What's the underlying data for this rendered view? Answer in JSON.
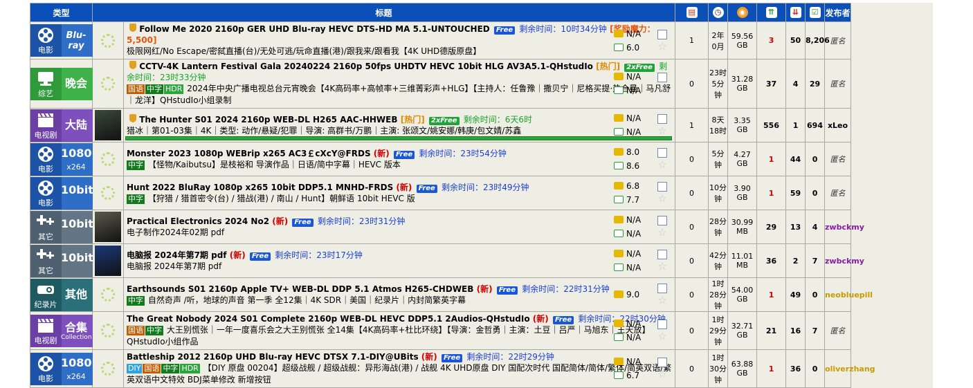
{
  "header": {
    "type_label": "类型",
    "title_label": "标题",
    "uploader_label": "发布者",
    "icon_names": [
      "comments-icon",
      "time-icon",
      "size-icon",
      "seeders-icon",
      "leechers-icon",
      "completed-icon"
    ]
  },
  "rows": [
    {
      "cat_label": "电影",
      "cat_big": "Blu-ray",
      "cat_sub": "",
      "cat_style": "c-blue",
      "cat_icon": "film-reel-icon",
      "poster": false,
      "title": "Follow Me 2020 2160p GER UHD Blu-ray HEVC DTS-HD MA 5.1-UNTOUCHED",
      "flag": "",
      "free": "Free",
      "remain": "剩余时间：10时34分钟",
      "magic": "[奖励魔力：5,500]",
      "tags": [],
      "subtitle": "极限网红/No Escape/密弑直播(台)/无处可逃/玩命直播(港)/跟我来/跟看我【4K UHD德版原盘】",
      "imdb": "N/A",
      "douban": "6.0",
      "comments": "1",
      "time": "2年\n0月",
      "size": "59.56\nGB",
      "seeders": "3",
      "seed_red": true,
      "leechers": "50",
      "completed": "8,206",
      "uploader": "匿名",
      "uploader_style": "anon"
    },
    {
      "cat_label": "综艺",
      "cat_big": "晚会",
      "cat_sub": "",
      "cat_style": "c-green",
      "cat_icon": "tv-stand-icon",
      "poster": false,
      "title": "CCTV-4K Lantern Festival Gala 20240224 2160p 50fps UHDTV HEVC 10bit HLG AV3A5.1-QHstudIo",
      "flag": "[热门]",
      "free": "2xFree",
      "remain": "剩余时间：23时33分钟",
      "magic": "",
      "tags": [
        "国语",
        "中字",
        "HDR"
      ],
      "subtitle": "2024年中央广播电视总台元宵晚会【4K高码率+高帧率+三维菁彩声+HLG】【主持人：任鲁豫｜撒贝宁｜尼格买提·热合曼｜马凡舒｜龙洋】QHstudIo小组录制",
      "imdb": "N/A",
      "douban": "N/A",
      "comments": "0",
      "time": "23时\n5分钟",
      "size": "31.28\nGB",
      "seeders": "37",
      "seed_red": false,
      "leechers": "4",
      "completed": "29",
      "uploader": "匿名",
      "uploader_style": "anon"
    },
    {
      "cat_label": "电视剧",
      "cat_big": "大陆",
      "cat_sub": "",
      "cat_style": "c-purple",
      "cat_icon": "clapperboard-icon",
      "poster": true,
      "poster_color": "#3a4a3a",
      "title": "The Hunter S01 2024 2160p WEB-DL H265 AAC-HHWEB",
      "flag": "[热门]",
      "free": "2xFree",
      "remain": "剩余时间：6天6时",
      "magic": "",
      "tags": [],
      "subtitle": "猎冰｜第01-03集｜4K｜类型: 动作/悬疑/犯罪｜导演: 高群书/万鹏｜主演: 张颂文/姚安娜/韩庚/包文婧/苏鑫",
      "imdb": "N/A",
      "douban": "N/A",
      "progress": 1.0,
      "comments": "1",
      "time": "8天\n18时",
      "size": "3.35\nGB",
      "seeders": "556",
      "seed_red": false,
      "leechers": "1",
      "completed": "694",
      "uploader": "xLeo",
      "uploader_style": "black"
    },
    {
      "cat_label": "电影",
      "cat_big": "1080",
      "cat_sub": "x264",
      "cat_style": "c-blue",
      "cat_icon": "film-reel-icon",
      "poster": false,
      "title": "Monster 2023 1080p WEBrip x265 AC3￡cXcY@FRDS",
      "flag": "(新)",
      "free": "Free",
      "remain": "剩余时间：23时54分钟",
      "magic": "",
      "tags": [
        "中字"
      ],
      "subtitle": "【怪物/Kaibutsu】是枝裕和 导演作品｜日语/简中字幕｜HEVC 版本",
      "imdb": "8.0",
      "douban": "8.6",
      "comments": "0",
      "time": "5分钟",
      "size": "4.27\nGB",
      "seeders": "1",
      "seed_red": true,
      "leechers": "44",
      "completed": "0",
      "uploader": "匿名",
      "uploader_style": "anon"
    },
    {
      "cat_label": "电影",
      "cat_big": "10bit",
      "cat_sub": "",
      "cat_style": "c-blue",
      "cat_icon": "film-reel-icon",
      "poster": false,
      "title": "Hunt 2022 BluRay 1080p x265 10bit DDP5.1 MNHD-FRDS",
      "flag": "(新)",
      "free": "Free",
      "remain": "剩余时间：23时49分钟",
      "magic": "",
      "tags": [
        "中字"
      ],
      "subtitle": "【狩猎 / 猎首密令(台) / 猎战(港) / 南山 / Hunt】朝鲜语 10bit HEVC 版",
      "imdb": "6.8",
      "douban": "7.7",
      "comments": "0",
      "time": "10分钟",
      "size": "3.90\nGB",
      "seeders": "1",
      "seed_red": true,
      "leechers": "59",
      "completed": "0",
      "uploader": "匿名",
      "uploader_style": "anon"
    },
    {
      "cat_label": "其它",
      "cat_big": "10bit",
      "cat_sub": "",
      "cat_style": "c-gray",
      "cat_icon": "plus-plus-icon",
      "poster": true,
      "poster_color": "#5a5a4a",
      "title": "Practical Electronics 2024 No2",
      "flag": "(新)",
      "free": "Free",
      "remain": "剩余时间：23时31分钟",
      "magic": "",
      "tags": [],
      "subtitle": "电子制作2024年02期 pdf",
      "imdb": "N/A",
      "douban": "N/A",
      "comments": "0",
      "time": "28分钟",
      "size": "30.99\nMB",
      "seeders": "29",
      "seed_red": false,
      "leechers": "13",
      "completed": "4",
      "uploader": "zwbckmy",
      "uploader_style": "purple"
    },
    {
      "cat_label": "其它",
      "cat_big": "10bit",
      "cat_sub": "",
      "cat_style": "c-gray",
      "cat_icon": "plus-plus-icon",
      "poster": true,
      "poster_color": "#1a3a7a",
      "title": "电脑报 2024年第7期 pdf",
      "flag": "(新)",
      "free": "Free",
      "remain": "剩余时间：23时17分钟",
      "magic": "",
      "tags": [],
      "subtitle": "电脑报 2024年第7期 pdf",
      "imdb": "N/A",
      "douban": "N/A",
      "comments": "0",
      "time": "42分钟",
      "size": "11.01\nMB",
      "seeders": "36",
      "seed_red": false,
      "leechers": "2",
      "completed": "7",
      "uploader": "zwbckmy",
      "uploader_style": "purple"
    },
    {
      "cat_label": "纪录片",
      "cat_big": "其他",
      "cat_sub": "",
      "cat_style": "c-teal",
      "cat_icon": "projector-icon",
      "poster": false,
      "title": "Earthsounds S01 2160p Apple TV+ WEB-DL DDP 5.1 Atmos H265-CHDWEB",
      "flag": "(新)",
      "free": "Free",
      "remain": "剩余时间：22时31分钟",
      "magic": "",
      "tags": [
        "中字"
      ],
      "subtitle": "自然奇声 /听，地球的声音 第一季 全12集｜4K SDR｜美国｜纪录片｜内封简繁英字幕",
      "imdb": "9.0",
      "douban": "",
      "comments": "0",
      "time": "1时\n28分钟",
      "size": "54.00\nGB",
      "seeders": "1",
      "seed_red": true,
      "leechers": "49",
      "completed": "0",
      "uploader": "neobluepill",
      "uploader_style": "gold"
    },
    {
      "cat_label": "电视剧",
      "cat_big": "合集",
      "cat_sub": "Collection",
      "cat_style": "c-purple",
      "cat_icon": "clapperboard-icon",
      "poster": false,
      "title": "The Great Nobody 2024 S01 Complete 2160p WEB-DL HEVC DDP5.1 2Audios-QHstudIo",
      "flag": "(新)",
      "free": "Free",
      "remain": "剩余时间：22时30分钟",
      "magic": "",
      "tags": [
        "国语",
        "中字"
      ],
      "subtitle": "大王别慌张｜一年一度喜乐会之大王别慌张 全14集【4K高码率+杜比环绕】【导演：金哲勇｜主演：土豆｜吕严｜马旭东｜王天放】QHstudIo小组作品",
      "imdb": "N/A",
      "douban": "N/A",
      "comments": "0",
      "time": "1时\n29分钟",
      "size": "32.71\nGB",
      "seeders": "21",
      "seed_red": false,
      "leechers": "16",
      "completed": "7",
      "uploader": "匿名",
      "uploader_style": "anon"
    },
    {
      "cat_label": "电影",
      "cat_big": "1080",
      "cat_sub": "x264",
      "cat_style": "c-blue",
      "cat_icon": "film-reel-icon",
      "poster": false,
      "title": "Battleship 2012 2160p UHD Blu-ray HEVC DTSX 7.1-DIY@UBits",
      "flag": "(新)",
      "free": "Free",
      "remain": "剩余时间：22时29分钟",
      "magic": "",
      "tags": [
        "DIY",
        "国语",
        "中字",
        "HDR"
      ],
      "subtitle": "【DIY 原盘 00204】超级战舰 / 超级战舰：异形海战(港) / 战舰 4K UHD原盘 DIY 国配次时代 国配简体/简体/繁体/简英双语/繁英双语中文特效 BDJ菜单修改 新增按钮",
      "imdb": "N/A",
      "douban": "6.7",
      "comments": "0",
      "time": "1时\n30分钟",
      "size": "63.88\nGB",
      "seeders": "1",
      "seed_red": true,
      "leechers": "36",
      "completed": "0",
      "uploader": "oliverzhang",
      "uploader_style": "gold"
    }
  ]
}
